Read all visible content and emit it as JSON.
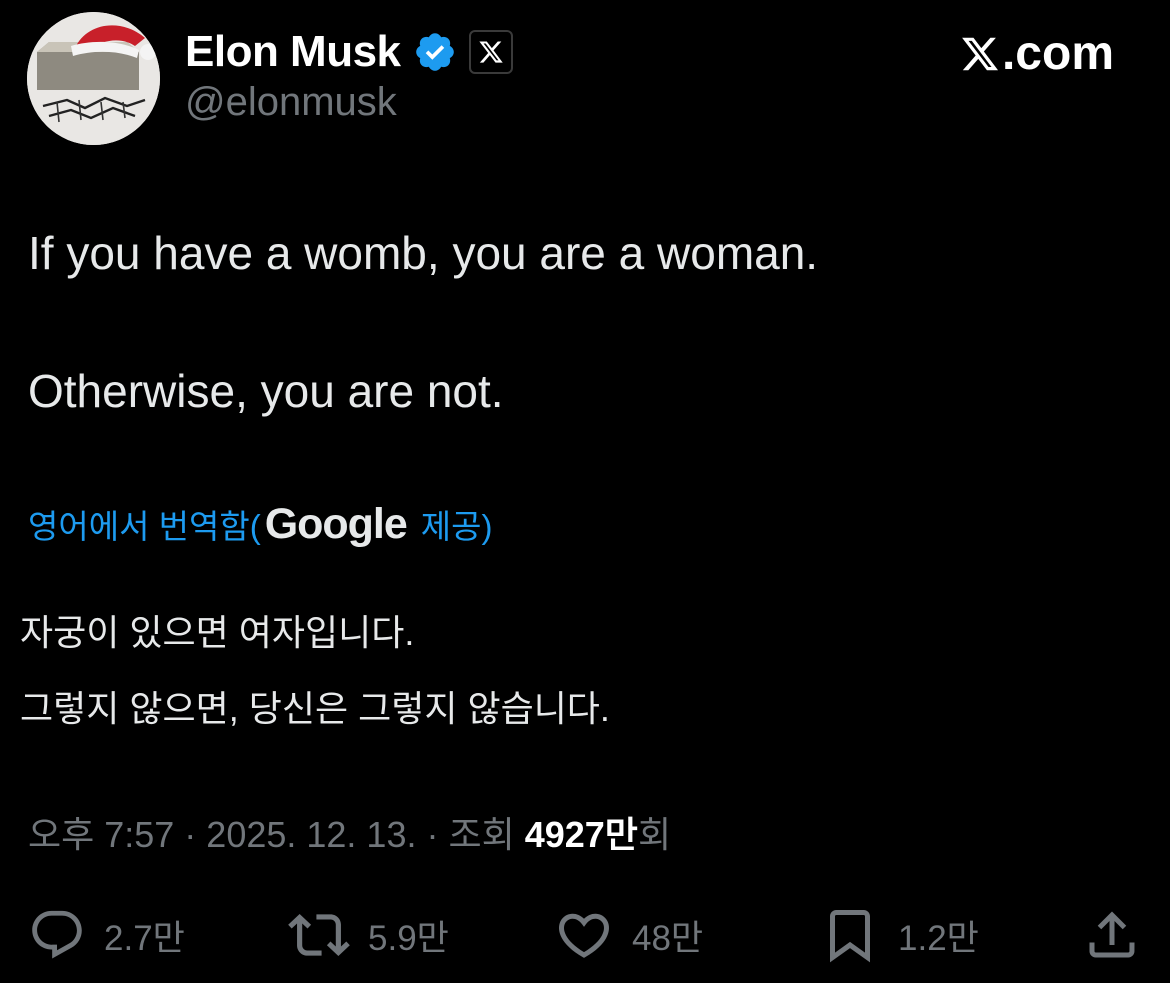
{
  "header": {
    "display_name": "Elon Musk",
    "handle": "@elonmusk",
    "site_domain": ".com",
    "site_logo": "x-logo-icon",
    "verified_icon": "verified-badge-icon",
    "affiliation_icon": "x-affiliation-icon"
  },
  "tweet": {
    "line1": "If you have a womb, you are a woman.",
    "line2": "Otherwise, you are not."
  },
  "translation": {
    "prefix": "영어에서 번역함(",
    "provider": "Google",
    "suffix": "제공)",
    "line1": "자궁이 있으면 여자입니다.",
    "line2": "그렇지 않으면, 당신은 그렇지 않습니다."
  },
  "meta": {
    "time_date": "오후 7:57 · 2025. 12. 13. · 조회 ",
    "views": "4927만",
    "views_suffix": "회"
  },
  "actions": {
    "reply": {
      "icon": "reply-icon",
      "count": "2.7만"
    },
    "repost": {
      "icon": "repost-icon",
      "count": "5.9만"
    },
    "like": {
      "icon": "heart-icon",
      "count": "48만"
    },
    "bookmark": {
      "icon": "bookmark-icon",
      "count": "1.2만"
    },
    "share": {
      "icon": "share-icon"
    }
  },
  "colors": {
    "background": "#000000",
    "text": "#e7e9ea",
    "muted": "#71767b",
    "link": "#1d9bf0",
    "verified": "#1d9bf0"
  }
}
